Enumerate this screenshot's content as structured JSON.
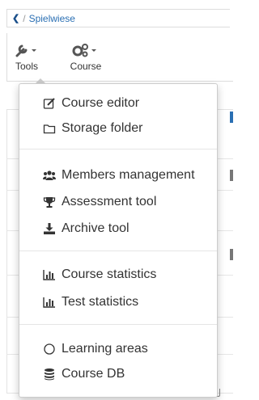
{
  "breadcrumb": {
    "back_icon": "chevron-left-icon",
    "separator": "/",
    "current": "Spielwiese"
  },
  "toolbar": {
    "tools": {
      "label": "Tools",
      "icon": "wrench-icon"
    },
    "course": {
      "label": "Course",
      "icon": "gears-icon"
    }
  },
  "menu": {
    "sections": [
      {
        "items": [
          {
            "label": "Course editor",
            "icon": "edit-icon"
          },
          {
            "label": "Storage folder",
            "icon": "folder-icon"
          }
        ]
      },
      {
        "items": [
          {
            "label": "Members management",
            "icon": "users-icon"
          },
          {
            "label": "Assessment tool",
            "icon": "trophy-icon"
          },
          {
            "label": "Archive tool",
            "icon": "download-icon"
          }
        ]
      },
      {
        "items": [
          {
            "label": "Course statistics",
            "icon": "bar-chart-icon"
          },
          {
            "label": "Test statistics",
            "icon": "bar-chart-icon"
          }
        ]
      },
      {
        "items": [
          {
            "label": "Learning areas",
            "icon": "circle-icon"
          },
          {
            "label": "Course DB",
            "icon": "database-icon"
          }
        ]
      }
    ]
  },
  "colors": {
    "link": "#2a6fb3",
    "text": "#333333",
    "border": "#cccccc"
  }
}
